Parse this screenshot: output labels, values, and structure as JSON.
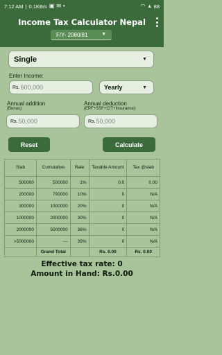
{
  "status": {
    "time": "7:12 AM",
    "speed": "0.1KB/s",
    "battery": "88"
  },
  "app": {
    "title": "Income Tax Calculator Nepal",
    "fiscal_year": "F/Y- 2080/81"
  },
  "form": {
    "status_select": "Single",
    "income_label": "Enter Income:",
    "income_prefix": "Rs.",
    "income_value": "600,000",
    "period_select": "Yearly",
    "addition_label": "Annual addition",
    "addition_sub": "(Bonus):",
    "addition_prefix": "Rs.",
    "addition_value": "50,000",
    "deduction_label": "Annual deduction",
    "deduction_sub": "(EPF+SSF+CIT+Insurance):",
    "deduction_prefix": "Rs.",
    "deduction_value": "50,000",
    "reset_label": "Reset",
    "calculate_label": "Calculate"
  },
  "table": {
    "headers": [
      "Slab",
      "Cumulative",
      "Rate",
      "Taxable Amount",
      "Tax @slab"
    ],
    "rows": [
      [
        "500000",
        "500000",
        "1%",
        "0.0",
        "0.00"
      ],
      [
        "200000",
        "700000",
        "10%",
        "0",
        "N/A"
      ],
      [
        "300000",
        "1000000",
        "20%",
        "0",
        "N/A"
      ],
      [
        "1000000",
        "2000000",
        "30%",
        "0",
        "N/A"
      ],
      [
        "2000000",
        "5000000",
        "36%",
        "0",
        "N/A"
      ],
      [
        ">5000000",
        "---",
        "39%",
        "0",
        "N/A"
      ]
    ],
    "grand_total_label": "Grand Total",
    "grand_total_taxable": "Rs. 0.00",
    "grand_total_tax": "Rs. 0.00"
  },
  "summary": {
    "effective_rate": "Effective tax rate: 0",
    "amount_in_hand": "Amount in Hand: Rs.0.00"
  },
  "colors": {
    "primary": "#3b6b3b",
    "background": "#a9c49b",
    "field": "#e7eee2"
  }
}
